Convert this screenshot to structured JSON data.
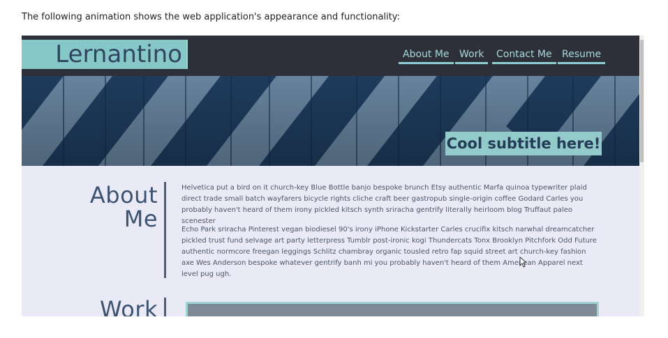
{
  "caption": "The following animation shows the web application's appearance and functionality:",
  "site": {
    "logo": "Lernantino",
    "nav": [
      {
        "label": "About Me"
      },
      {
        "label": "Work"
      },
      {
        "label": "Contact Me"
      },
      {
        "label": "Resume"
      }
    ],
    "hero": {
      "subtitle": "Cool subtitle here!"
    },
    "about": {
      "title_line1": "About",
      "title_line2": "Me",
      "paragraphs": [
        "Helvetica put a bird on it church-key Blue Bottle banjo bespoke brunch Etsy authentic Marfa quinoa typewriter plaid direct trade small batch wayfarers bicycle rights cliche craft beer gastropub single-origin coffee Godard Carles you probably haven't heard of them irony pickled kitsch synth sriracha gentrify literally heirloom blog Truffaut paleo scenester",
        "Echo Park sriracha Pinterest vegan biodiesel 90's irony iPhone Kickstarter Carles crucifix kitsch narwhal dreamcatcher pickled trust fund selvage art party letterpress Tumblr post-ironic kogi Thundercats Tonx Brooklyn Pitchfork Odd Future authentic normcore freegan leggings Schlitz chambray organic tousled retro fap squid street art church-key fashion axe Wes Anderson bespoke whatever gentrify banh mi you probably haven't heard of them American Apparel next level pug ugh."
      ]
    },
    "work": {
      "title": "Work"
    }
  },
  "colors": {
    "topbar": "#2d3038",
    "accent": "#86c8c8",
    "heading": "#3d526f",
    "page_bg": "#e9eaf5"
  }
}
